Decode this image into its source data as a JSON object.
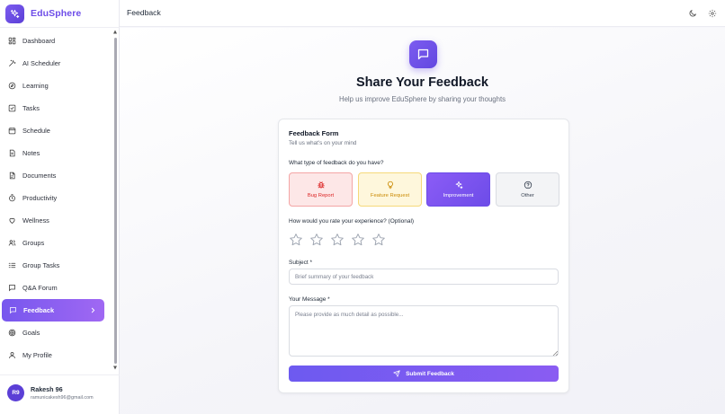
{
  "app": {
    "name": "EduSphere"
  },
  "sidebar": {
    "items": [
      {
        "label": "Dashboard",
        "icon": "grid-icon"
      },
      {
        "label": "AI Scheduler",
        "icon": "wand-icon"
      },
      {
        "label": "Learning",
        "icon": "compass-icon"
      },
      {
        "label": "Tasks",
        "icon": "checkbox-icon"
      },
      {
        "label": "Schedule",
        "icon": "calendar-icon"
      },
      {
        "label": "Notes",
        "icon": "note-icon"
      },
      {
        "label": "Documents",
        "icon": "document-icon"
      },
      {
        "label": "Productivity",
        "icon": "timer-icon"
      },
      {
        "label": "Wellness",
        "icon": "heart-icon"
      },
      {
        "label": "Groups",
        "icon": "users-icon"
      },
      {
        "label": "Group Tasks",
        "icon": "list-icon"
      },
      {
        "label": "Q&A Forum",
        "icon": "chat-icon"
      },
      {
        "label": "Feedback",
        "icon": "chat-icon",
        "active": true
      },
      {
        "label": "Goals",
        "icon": "target-icon"
      },
      {
        "label": "My Profile",
        "icon": "user-icon"
      }
    ]
  },
  "user": {
    "initials": "R9",
    "name": "Rakesh 96",
    "email": "ramunicakesh96@gmail.com"
  },
  "topbar": {
    "title": "Feedback"
  },
  "hero": {
    "title": "Share Your Feedback",
    "subtitle": "Help us improve EduSphere by sharing your thoughts"
  },
  "form": {
    "title": "Feedback Form",
    "subtitle": "Tell us what's on your mind",
    "type_question": "What type of feedback do you have?",
    "types": [
      {
        "label": "Bug Report",
        "icon": "bug-icon"
      },
      {
        "label": "Feature Request",
        "icon": "lightbulb-icon"
      },
      {
        "label": "Improvement",
        "icon": "sparkles-icon",
        "selected": true
      },
      {
        "label": "Other",
        "icon": "question-icon"
      }
    ],
    "rating_question": "How would you rate your experience? (Optional)",
    "rating": 0,
    "rating_max": 5,
    "subject_label": "Subject *",
    "subject_placeholder": "Brief summary of your feedback",
    "message_label": "Your Message *",
    "message_placeholder": "Please provide as much detail as possible...",
    "submit_label": "Submit Feedback"
  },
  "colors": {
    "accent": "#6d4ce8",
    "bug": "#dc2626",
    "feature": "#ca8a04"
  }
}
